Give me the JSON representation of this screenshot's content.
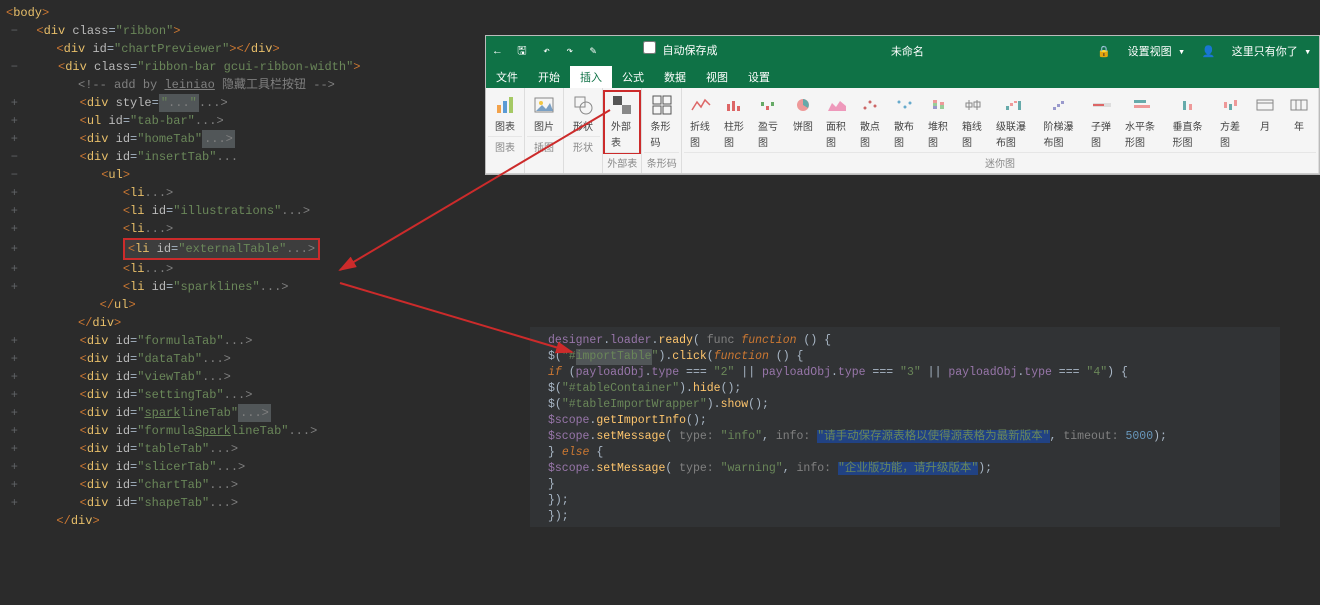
{
  "leftCode": {
    "body": "body",
    "div": "div",
    "ul": "ul",
    "li": "li",
    "classAttr": "class",
    "idAttr": "id",
    "styleAttr": "style",
    "ribbon": "ribbon",
    "chartPreviewer": "chartPreviewer",
    "ribbonBar": "ribbon-bar gcui-ribbon-width",
    "comment": "<!-- add by leiniao 隐藏工具栏按钮 -->",
    "tabBar": "tab-bar",
    "homeTab": "homeTab",
    "insertTab": "insertTab",
    "illustrations": "illustrations",
    "externalTable": "externalTable",
    "sparklines": "sparklines",
    "formulaTab": "formulaTab",
    "dataTab": "dataTab",
    "viewTab": "viewTab",
    "settingTab": "settingTab",
    "sparklineTab": "sparklineTab",
    "formulaSparklineTab": "formulaSparklineTab",
    "tableTab": "tableTab",
    "slicerTab": "slicerTab",
    "chartTab": "chartTab",
    "shapeTab": "shapeTab",
    "lei": "lei",
    "niao": "niao",
    "Spark": "Spark",
    "spark": "spark"
  },
  "ribbon": {
    "autosave": "自动保存成",
    "title": "未命名",
    "setView": "设置视图",
    "onlyHere": "这里只有你了",
    "lock_icon": "🔒",
    "tabs": [
      "文件",
      "开始",
      "插入",
      "公式",
      "数据",
      "视图",
      "设置"
    ],
    "activeTab": 2,
    "groups": [
      {
        "label": "图表",
        "items": [
          {
            "n": "图表",
            "ic": "bar-chart"
          }
        ]
      },
      {
        "label": "插图",
        "items": [
          {
            "n": "图片",
            "ic": "pic"
          }
        ]
      },
      {
        "label": "形状",
        "items": [
          {
            "n": "形状",
            "ic": "shape"
          }
        ]
      },
      {
        "label": "外部表",
        "items": [
          {
            "n": "外部表",
            "ic": "ext",
            "hi": true
          }
        ]
      },
      {
        "label": "条形码",
        "items": [
          {
            "n": "条形码",
            "ic": "barcode"
          }
        ]
      },
      {
        "label": "迷你图",
        "items": [
          {
            "n": "折线图",
            "ic": "line"
          },
          {
            "n": "柱形图",
            "ic": "col"
          },
          {
            "n": "盈亏图",
            "ic": "wl"
          },
          {
            "n": "饼图",
            "ic": "pie"
          },
          {
            "n": "面积图",
            "ic": "area"
          },
          {
            "n": "散点图",
            "ic": "scatter"
          },
          {
            "n": "散布图",
            "ic": "spread"
          },
          {
            "n": "堆积图",
            "ic": "stack"
          },
          {
            "n": "箱线图",
            "ic": "box"
          },
          {
            "n": "级联瀑布图",
            "ic": "casc"
          },
          {
            "n": "阶梯瀑布图",
            "ic": "step"
          },
          {
            "n": "子弹图",
            "ic": "bullet"
          },
          {
            "n": "水平条形图",
            "ic": "hbar"
          },
          {
            "n": "垂直条形图",
            "ic": "vbar"
          },
          {
            "n": "方差图",
            "ic": "var"
          },
          {
            "n": "月",
            "ic": "month"
          },
          {
            "n": "年",
            "ic": "year"
          }
        ]
      }
    ]
  },
  "darkCode": {
    "designer": "designer",
    "loader": "loader",
    "ready": "ready",
    "func": "func",
    "function": "function",
    "importTable": "importTable",
    "click": "click",
    "if": "if",
    "payloadObj": "payloadObj",
    "type": "type",
    "eq3": "===",
    "two": "\"2\"",
    "three": "\"3\"",
    "four": "\"4\"",
    "tableContainer": "\"#tableContainer\"",
    "hide": "hide",
    "tableImportWrapper": "\"#tableImportWrapper\"",
    "show": "show",
    "scope": "$scope",
    "getImportInfo": "getImportInfo",
    "setMessage": "setMessage",
    "info": "\"info\"",
    "info_lbl": "info:",
    "type_lbl": "type:",
    "timeout_lbl": "timeout:",
    "msg1": "\"请手动保存源表格以使得源表格为最新版本\"",
    "timeout": "5000",
    "else": "else",
    "warning": "\"warning\"",
    "msg2": "\"企业版功能，请升级版本\"",
    "hash": "\"#",
    "quote": "\""
  }
}
